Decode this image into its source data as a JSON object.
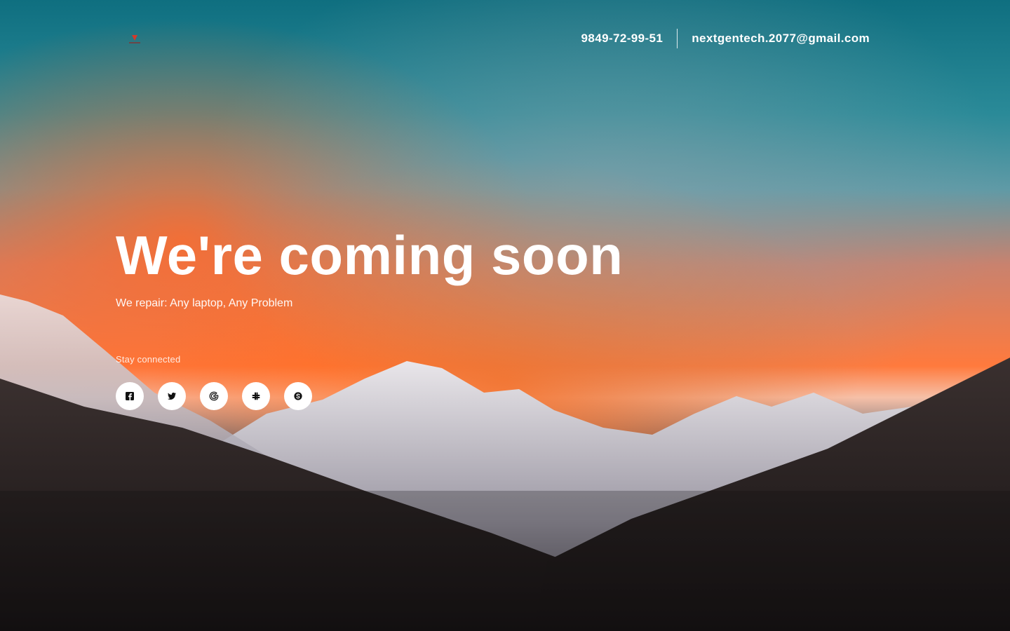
{
  "header": {
    "logo_icon": "logo-icon",
    "phone": "9849-72-99-51",
    "email": "nextgentech.2077@gmail.com"
  },
  "hero": {
    "title": "We're coming soon",
    "subtitle": "We repair: Any laptop, Any Problem"
  },
  "connect": {
    "label": "Stay connected",
    "socials": [
      {
        "icon": "facebook-icon"
      },
      {
        "icon": "twitter-icon"
      },
      {
        "icon": "google-icon"
      },
      {
        "icon": "slack-icon"
      },
      {
        "icon": "skype-icon"
      }
    ]
  },
  "colors": {
    "sky_top": "#0f6f80",
    "sunset": "#ff7a3d",
    "mountain_dark": "#2a2226",
    "text": "#ffffff",
    "social_bg": "#ffffff"
  }
}
